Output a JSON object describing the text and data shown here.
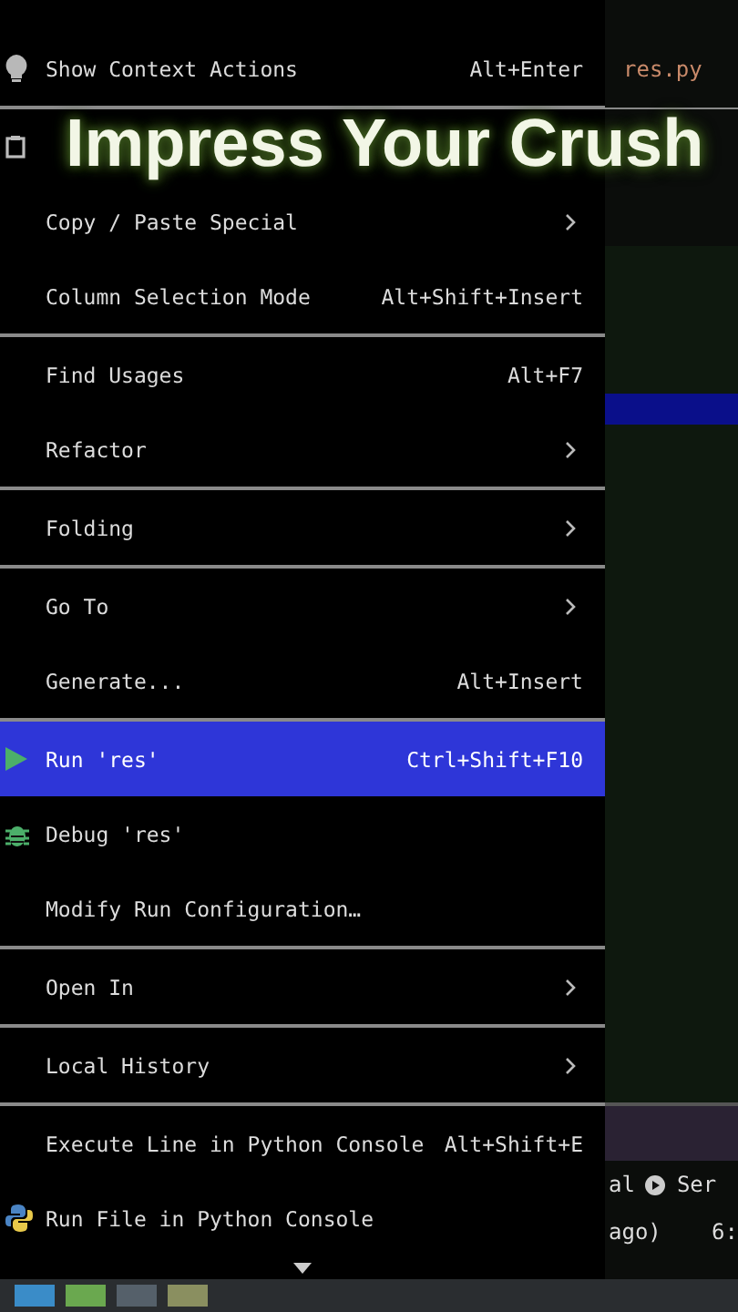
{
  "caption": "Impress Your Crush",
  "menu": {
    "items": [
      {
        "label": "Show Context Actions",
        "shortcut": "Alt+Enter",
        "kind": "bulb",
        "submenu": false,
        "separator_before": false,
        "selected": false
      },
      {
        "kind": "paste",
        "submenu": false,
        "separator_before": true,
        "selected": false
      },
      {
        "label": "Copy / Paste Special",
        "kind": "plain",
        "submenu": true,
        "separator_before": false,
        "selected": false
      },
      {
        "label": "Column Selection Mode",
        "shortcut": "Alt+Shift+Insert",
        "kind": "plain",
        "submenu": false,
        "separator_before": false,
        "selected": false
      },
      {
        "label": "Find Usages",
        "shortcut": "Alt+F7",
        "kind": "plain",
        "submenu": false,
        "separator_before": true,
        "selected": false
      },
      {
        "label": "Refactor",
        "kind": "plain",
        "submenu": true,
        "separator_before": false,
        "selected": false
      },
      {
        "label": "Folding",
        "kind": "plain",
        "submenu": true,
        "separator_before": true,
        "selected": false
      },
      {
        "label": "Go To",
        "kind": "plain",
        "submenu": true,
        "separator_before": true,
        "selected": false
      },
      {
        "label": "Generate...",
        "shortcut": "Alt+Insert",
        "kind": "plain",
        "submenu": false,
        "separator_before": false,
        "selected": false
      },
      {
        "label": "Run 'res'",
        "shortcut": "Ctrl+Shift+F10",
        "kind": "run",
        "submenu": false,
        "separator_before": true,
        "selected": true
      },
      {
        "label": "Debug 'res'",
        "kind": "debug",
        "submenu": false,
        "separator_before": false,
        "selected": false
      },
      {
        "label": "Modify Run Configuration…",
        "kind": "plain",
        "submenu": false,
        "separator_before": false,
        "selected": false
      },
      {
        "label": "Open In",
        "kind": "plain",
        "submenu": true,
        "separator_before": true,
        "selected": false
      },
      {
        "label": "Local History",
        "kind": "plain",
        "submenu": true,
        "separator_before": true,
        "selected": false
      },
      {
        "label": "Execute Line in Python Console",
        "shortcut": "Alt+Shift+E",
        "kind": "plain",
        "submenu": false,
        "separator_before": true,
        "selected": false
      },
      {
        "label": "Run File in Python Console",
        "kind": "python",
        "submenu": false,
        "separator_before": false,
        "selected": false
      }
    ]
  },
  "editor": {
    "tab": {
      "label": "res.py",
      "selected": true
    }
  },
  "status": {
    "left": "al",
    "service": "Ser",
    "time_ago": "ago)",
    "position": "6:"
  }
}
